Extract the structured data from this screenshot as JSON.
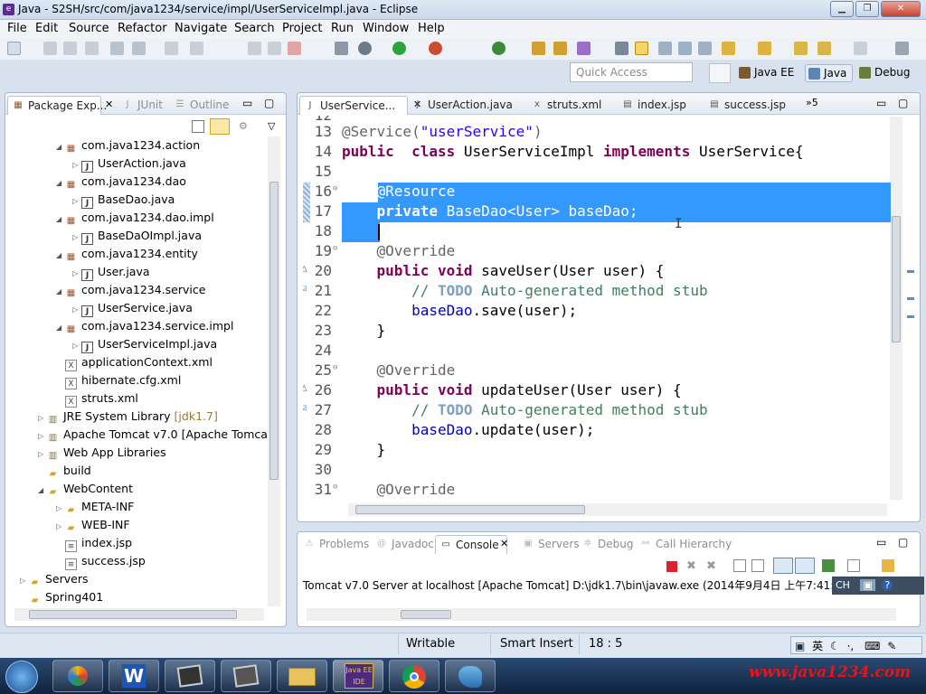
{
  "window": {
    "title": "Java - S2SH/src/com/java1234/service/impl/UserServiceImpl.java - Eclipse"
  },
  "menu": [
    "File",
    "Edit",
    "Source",
    "Refactor",
    "Navigate",
    "Search",
    "Project",
    "Run",
    "Window",
    "Help"
  ],
  "quick_access": {
    "placeholder": "Quick Access"
  },
  "perspectives": [
    "Java EE",
    "Java",
    "Debug"
  ],
  "left_tabs": [
    "Package Exp...",
    "JUnit",
    "Outline"
  ],
  "tree": [
    {
      "label": "com.java1234.action",
      "type": "pkg",
      "indent": 60,
      "twisty": "◢"
    },
    {
      "label": "UserAction.java",
      "type": "java",
      "indent": 78,
      "twisty": "▷"
    },
    {
      "label": "com.java1234.dao",
      "type": "pkg",
      "indent": 60,
      "twisty": "◢"
    },
    {
      "label": "BaseDao.java",
      "type": "java",
      "indent": 78,
      "twisty": "▷"
    },
    {
      "label": "com.java1234.dao.impl",
      "type": "pkg",
      "indent": 60,
      "twisty": "◢"
    },
    {
      "label": "BaseDaOImpl.java",
      "type": "java",
      "indent": 78,
      "twisty": "▷"
    },
    {
      "label": "com.java1234.entity",
      "type": "pkg",
      "indent": 60,
      "twisty": "◢"
    },
    {
      "label": "User.java",
      "type": "java",
      "indent": 78,
      "twisty": "▷"
    },
    {
      "label": "com.java1234.service",
      "type": "pkg",
      "indent": 60,
      "twisty": "◢"
    },
    {
      "label": "UserService.java",
      "type": "java",
      "indent": 78,
      "twisty": "▷"
    },
    {
      "label": "com.java1234.service.impl",
      "type": "pkg",
      "indent": 60,
      "twisty": "◢"
    },
    {
      "label": "UserServiceImpl.java",
      "type": "java",
      "indent": 78,
      "twisty": "▷"
    },
    {
      "label": "applicationContext.xml",
      "type": "xml",
      "indent": 60,
      "twisty": ""
    },
    {
      "label": "hibernate.cfg.xml",
      "type": "xml",
      "indent": 60,
      "twisty": ""
    },
    {
      "label": "struts.xml",
      "type": "xml",
      "indent": 60,
      "twisty": ""
    },
    {
      "label": "JRE System Library",
      "suffix": "[jdk1.7]",
      "type": "lib",
      "indent": 40,
      "twisty": "▷"
    },
    {
      "label": "Apache Tomcat v7.0 [Apache Tomcat",
      "type": "lib",
      "indent": 40,
      "twisty": "▷"
    },
    {
      "label": "Web App Libraries",
      "type": "lib",
      "indent": 40,
      "twisty": "▷"
    },
    {
      "label": "build",
      "type": "folder",
      "indent": 40,
      "twisty": ""
    },
    {
      "label": "WebContent",
      "type": "folder",
      "indent": 40,
      "twisty": "◢"
    },
    {
      "label": "META-INF",
      "type": "folder",
      "indent": 60,
      "twisty": "▷"
    },
    {
      "label": "WEB-INF",
      "type": "folder",
      "indent": 60,
      "twisty": "▷"
    },
    {
      "label": "index.jsp",
      "type": "file",
      "indent": 60,
      "twisty": ""
    },
    {
      "label": "success.jsp",
      "type": "file",
      "indent": 60,
      "twisty": ""
    },
    {
      "label": "Servers",
      "type": "folder",
      "indent": 20,
      "twisty": "▷"
    },
    {
      "label": "Spring401",
      "type": "project",
      "indent": 20,
      "twisty": ""
    }
  ],
  "editor_tabs": [
    "UserService...",
    "UserAction.java",
    "struts.xml",
    "index.jsp",
    "success.jsp"
  ],
  "editor_overflow": "»5",
  "code_lines": [
    {
      "n": "13",
      "segs": [
        [
          "an",
          "@Service("
        ],
        [
          "st",
          "\"userService\""
        ],
        [
          "an",
          ")"
        ]
      ]
    },
    {
      "n": "14",
      "segs": [
        [
          "kw",
          "public"
        ],
        [
          "",
          "  "
        ],
        [
          "kw",
          "class"
        ],
        [
          "",
          " UserServiceImpl "
        ],
        [
          "kw",
          "implements"
        ],
        [
          "",
          " UserService{"
        ]
      ]
    },
    {
      "n": "15",
      "segs": []
    },
    {
      "n": "16",
      "sel": true,
      "fold": true,
      "segs": [
        [
          "",
          "    @Resource"
        ]
      ]
    },
    {
      "n": "17",
      "sel": true,
      "segs": [
        [
          "",
          "    "
        ],
        [
          "b",
          "private"
        ],
        [
          "",
          " BaseDao<User> baseDao;"
        ]
      ]
    },
    {
      "n": "18",
      "selpart": true,
      "segs": [
        [
          "",
          "    "
        ]
      ]
    },
    {
      "n": "19",
      "fold": true,
      "segs": [
        [
          "an",
          "    @Override"
        ]
      ]
    },
    {
      "n": "20",
      "mark": "△",
      "segs": [
        [
          "",
          "    "
        ],
        [
          "kw",
          "public"
        ],
        [
          "",
          " "
        ],
        [
          "kw",
          "void"
        ],
        [
          "",
          " saveUser(User user) {"
        ]
      ]
    },
    {
      "n": "21",
      "mark": "☑",
      "segs": [
        [
          "cm",
          "        // "
        ],
        [
          "td",
          "TODO"
        ],
        [
          "cm",
          " Auto-generated method stub"
        ]
      ]
    },
    {
      "n": "22",
      "segs": [
        [
          "",
          "        "
        ],
        [
          "fld",
          "baseDao"
        ],
        [
          "",
          ".save(user);"
        ]
      ]
    },
    {
      "n": "23",
      "segs": [
        [
          "",
          "    }"
        ]
      ]
    },
    {
      "n": "24",
      "segs": []
    },
    {
      "n": "25",
      "fold": true,
      "segs": [
        [
          "an",
          "    @Override"
        ]
      ]
    },
    {
      "n": "26",
      "mark": "△",
      "segs": [
        [
          "",
          "    "
        ],
        [
          "kw",
          "public"
        ],
        [
          "",
          " "
        ],
        [
          "kw",
          "void"
        ],
        [
          "",
          " updateUser(User user) {"
        ]
      ]
    },
    {
      "n": "27",
      "mark": "☑",
      "segs": [
        [
          "cm",
          "        // "
        ],
        [
          "td",
          "TODO"
        ],
        [
          "cm",
          " Auto-generated method stub"
        ]
      ]
    },
    {
      "n": "28",
      "segs": [
        [
          "",
          "        "
        ],
        [
          "fld",
          "baseDao"
        ],
        [
          "",
          ".update(user);"
        ]
      ]
    },
    {
      "n": "29",
      "segs": [
        [
          "",
          "    }"
        ]
      ]
    },
    {
      "n": "30",
      "segs": []
    },
    {
      "n": "31",
      "fold": true,
      "segs": [
        [
          "an",
          "    @Override"
        ]
      ]
    }
  ],
  "bottom_tabs": [
    "Problems",
    "Javadoc",
    "Console",
    "Servers",
    "Debug",
    "Call Hierarchy"
  ],
  "console": {
    "text": "Tomcat v7.0 Server at localhost [Apache Tomcat] D:\\jdk1.7\\bin\\javaw.exe (2014年9月4日 上午7:41:23)"
  },
  "status": {
    "writable": "Writable",
    "insert_mode": "Smart Insert",
    "position": "18 : 5"
  },
  "ime": {
    "lang": "CH",
    "mode": "英"
  },
  "watermark": "www.java1234.com",
  "colors": {
    "selection": "#3399ff",
    "keyword": "#7f0055",
    "comment": "#3f7f5f",
    "string": "#2a00ff"
  }
}
